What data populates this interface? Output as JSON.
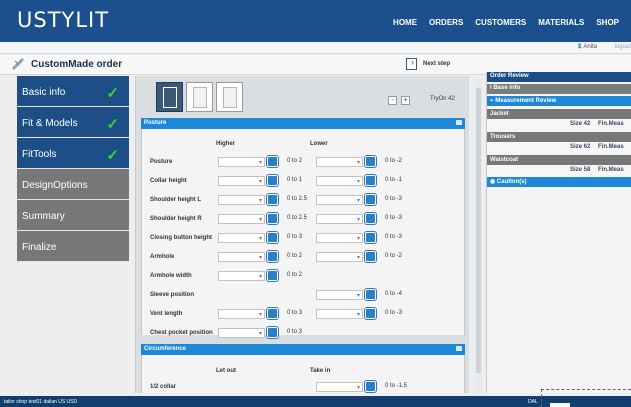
{
  "app": {
    "logo": "USTYLIT",
    "top_nav": [
      "HOME",
      "ORDERS",
      "CUSTOMERS",
      "MATERIALS",
      "SHOP"
    ],
    "user": "Anita",
    "logout": "logout"
  },
  "order": {
    "title": "CustomMade order",
    "next_step": "Next step"
  },
  "sidebar": {
    "items": [
      {
        "label": "Basic info",
        "done": true
      },
      {
        "label": "Fit & Models",
        "done": true
      },
      {
        "label": "FitTools",
        "done": true
      },
      {
        "label": "DesignOptions",
        "done": false
      },
      {
        "label": "Summary",
        "done": false
      },
      {
        "label": "Finalize",
        "done": false
      }
    ]
  },
  "toolbar": {
    "zoom_minus": "-",
    "zoom_plus": "+",
    "tryon": "TryOn 42"
  },
  "posture": {
    "title": "Posture",
    "higher": "Higher",
    "lower": "Lower",
    "rows": [
      {
        "label": "Posture",
        "high": "0 to 2",
        "low": "0 to -2"
      },
      {
        "label": "Collar height",
        "high": "0 to 1",
        "low": "0 to -1"
      },
      {
        "label": "Shoulder height L",
        "high": "0 to 2.5",
        "low": "0 to -3"
      },
      {
        "label": "Shoulder height R",
        "high": "0 to 2.5",
        "low": "0 to -3"
      },
      {
        "label": "Closing button height",
        "high": "0 to 3",
        "low": "0 to -3"
      },
      {
        "label": "Armhole",
        "high": "0 to 2",
        "low": "0 to -2"
      },
      {
        "label": "Armhole width",
        "high": "0 to 2",
        "low": ""
      },
      {
        "label": "Sleeve position",
        "high": "",
        "low": "0 to -4"
      },
      {
        "label": "Vent length",
        "high": "0 to 3",
        "low": "0 to -3"
      },
      {
        "label": "Chest pocket position",
        "high": "0 to 3",
        "low": ""
      }
    ]
  },
  "circumference": {
    "title": "Circumference",
    "let_out": "Let out",
    "take_in": "Take in",
    "rows": [
      {
        "label": "1/2 collar",
        "high": "",
        "low": "0 to -1.5"
      }
    ]
  },
  "review": {
    "title": "Order Review",
    "basic_info": "Base info",
    "measurement_review": "Measurement Review",
    "jacket": {
      "name": "Jacket",
      "size": "Size 42",
      "fin": "Fin.Meas"
    },
    "trousers": {
      "name": "Trousers",
      "size": "Size 62",
      "fin": "Fin.Meas"
    },
    "waistcoat": {
      "name": "Waistcoat",
      "size": "Size 58",
      "fin": "Fin.Meas"
    },
    "cautions": "Caution(s)"
  },
  "footer": {
    "left": "tailor shop test01  dalian  US  USD",
    "right": "DAL"
  },
  "colors": {
    "primary": "#1b4f8e",
    "accent": "#1e88d6",
    "success": "#39d23a"
  }
}
